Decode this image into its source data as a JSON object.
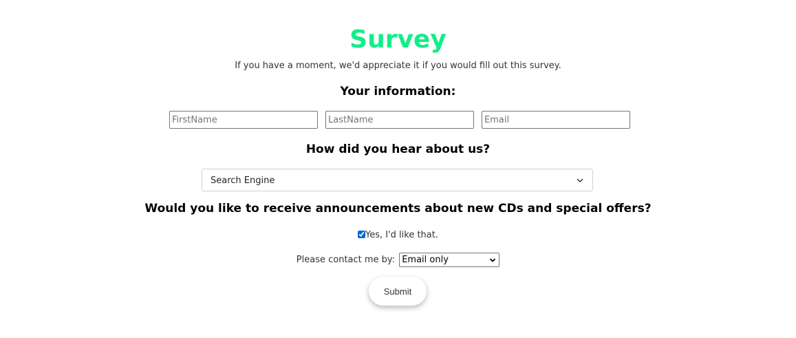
{
  "header": {
    "title": "Survey",
    "subtitle": "If you have a moment, we'd appreciate it if you would fill out this survey."
  },
  "info_section": {
    "heading": "Your information:",
    "first_name": {
      "placeholder": "FirstName",
      "value": ""
    },
    "last_name": {
      "placeholder": "LastName",
      "value": ""
    },
    "email": {
      "placeholder": "Email",
      "value": ""
    }
  },
  "source_section": {
    "heading": "How did you hear about us?",
    "selected": "Search Engine",
    "chevron_icon": "chevron-down-icon"
  },
  "announce_section": {
    "heading": "Would you like to receive announcements about new CDs and special offers?",
    "checkbox_label": "Yes, I'd like that.",
    "checked": true,
    "contact_label": "Please contact me by:",
    "contact_selected": "Email only"
  },
  "submit": {
    "label": "Submit"
  },
  "colors": {
    "title": "#11ee88",
    "checkbox_accent": "#0a66d6"
  }
}
